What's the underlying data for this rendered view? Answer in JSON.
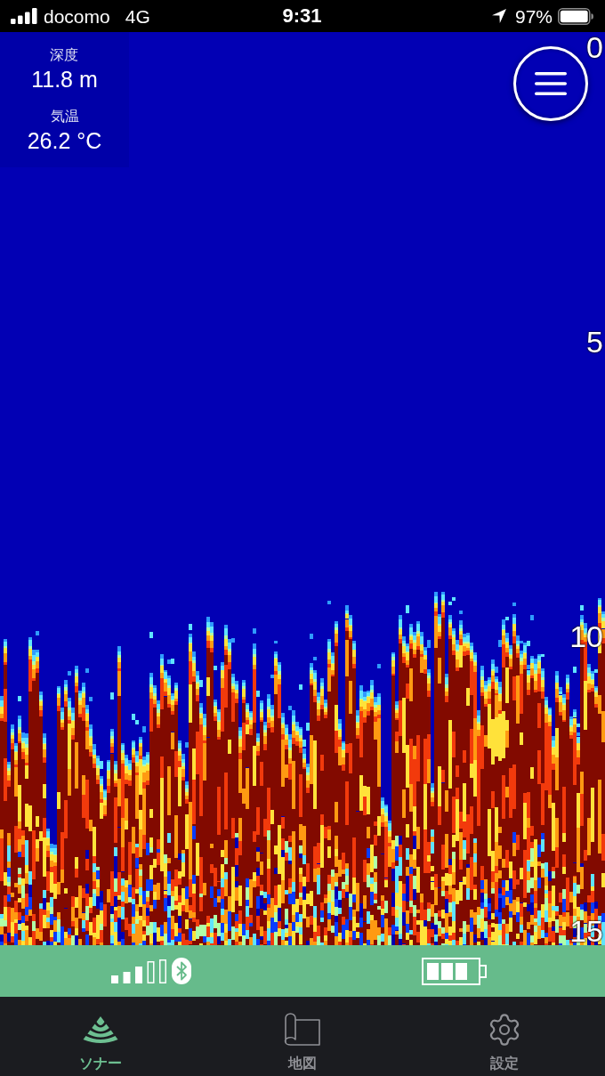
{
  "status_bar": {
    "carrier": "docomo",
    "network": "4G",
    "time": "9:31",
    "battery_percent": "97%"
  },
  "readouts": [
    {
      "label": "深度",
      "value": "11.8 m"
    },
    {
      "label": "気温",
      "value": "26.2 °C"
    }
  ],
  "depth_scale": [
    "0",
    "5",
    "10",
    "15"
  ],
  "tabs": [
    {
      "kind": "sonar",
      "label": "ソナー",
      "selected": true
    },
    {
      "kind": "map",
      "label": "地図",
      "selected": false
    },
    {
      "kind": "settings",
      "label": "設定",
      "selected": false
    }
  ]
}
